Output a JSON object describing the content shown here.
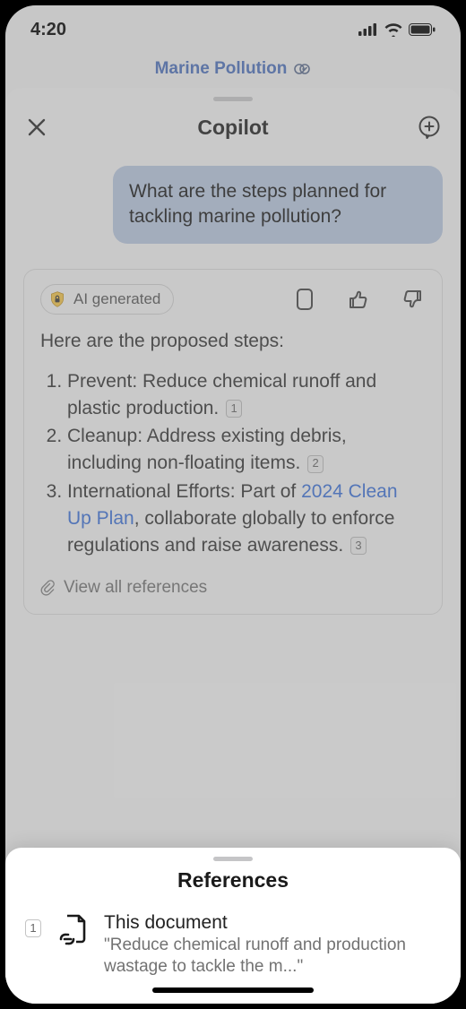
{
  "status": {
    "time": "4:20"
  },
  "background": {
    "doc_title": "Marine Pollution"
  },
  "copilot": {
    "title": "Copilot",
    "user_message": "What are the steps planned for tackling marine pollution?",
    "ai_badge": "AI generated",
    "response_intro": "Here are the proposed steps:",
    "items": [
      {
        "prefix": "Prevent: ",
        "body": "Reduce chemical runoff and plastic production.",
        "cite": "1"
      },
      {
        "prefix": "Cleanup: ",
        "body": "Address existing debris, including non-floating items.",
        "cite": "2"
      },
      {
        "prefix": "International Efforts: ",
        "link": "2024 Clean Up Plan",
        "body_before_link": "Part of ",
        "body_after_link": ", collaborate globally to enforce regulations and raise awareness.",
        "cite": "3"
      }
    ],
    "view_refs_label": "View all references"
  },
  "references": {
    "title": "References",
    "items": [
      {
        "num": "1",
        "doc_label": "This document",
        "snippet": "\"Reduce chemical runoff and production wastage to tackle the m...\""
      }
    ]
  }
}
